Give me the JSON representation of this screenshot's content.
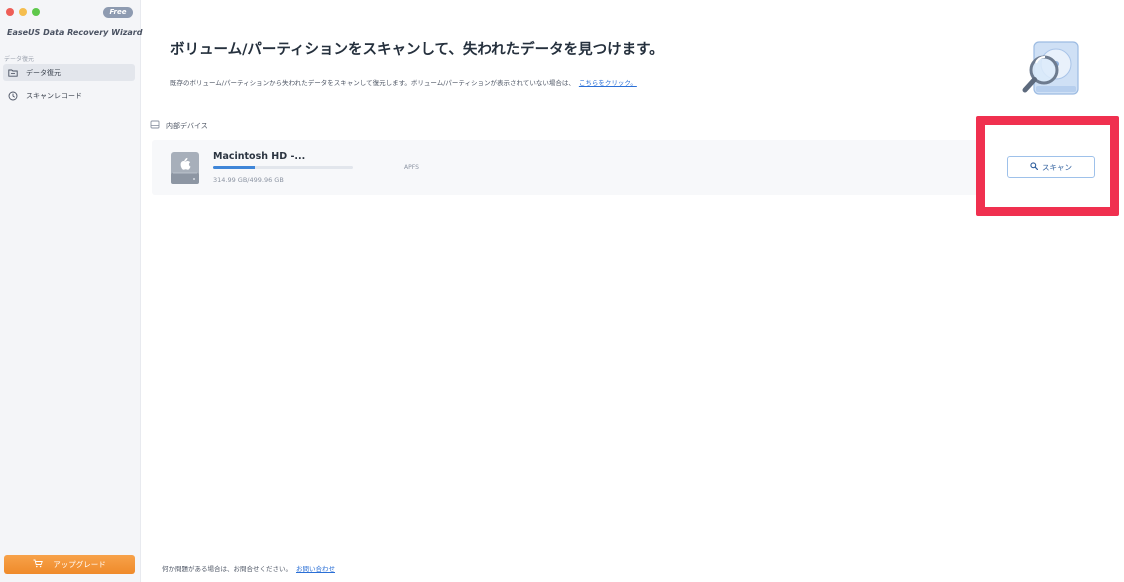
{
  "window": {
    "app_name": "EaseUS Data Recovery Wizard",
    "badge": "Free"
  },
  "sidebar": {
    "section_label": "データ復元",
    "items": [
      {
        "label": "データ復元",
        "icon": "folder-icon",
        "active": true
      },
      {
        "label": "スキャンレコード",
        "icon": "clock-icon",
        "active": false
      }
    ],
    "upgrade_label": "アップグレード",
    "upgrade_icon": "cart-icon"
  },
  "main": {
    "title": "ボリューム/パーティションをスキャンして、失われたデータを見つけます。",
    "description": "既存のボリューム/パーティションから失われたデータをスキャンして復元します。ボリューム/パーティションが表示されていない場合は、",
    "description_link": "こちらをクリック。",
    "hero_icon": "disk-magnifier-icon",
    "group_label": "内部デバイス",
    "devices": [
      {
        "name": "Macintosh HD -...",
        "size": "314.99 GB/499.96 GB",
        "used_fraction": 0.3,
        "filesystem": "APFS",
        "icon": "apple-drive-icon",
        "scan_label": "スキャン"
      }
    ]
  },
  "footer": {
    "text": "何か問題がある場合は、お問合せください。",
    "link": "お問い合わせ"
  },
  "colors": {
    "accent": "#3f86d8",
    "upgrade": "#ef8a2a",
    "highlight": "#f0304f"
  }
}
